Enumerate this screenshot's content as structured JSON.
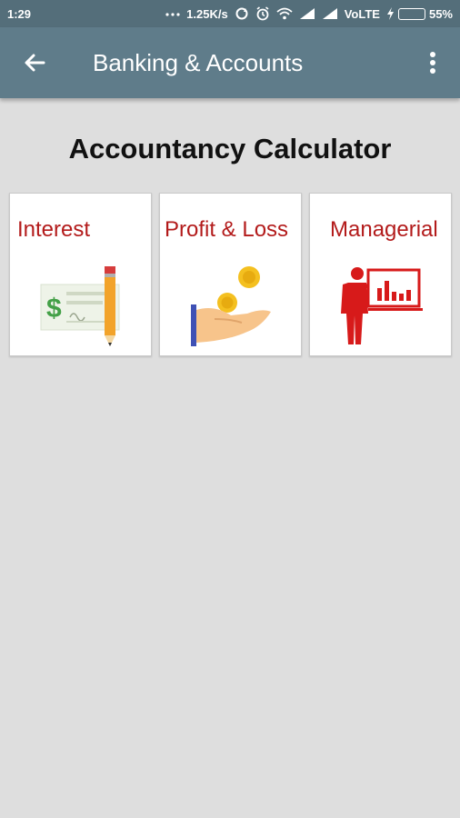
{
  "status": {
    "time": "1:29",
    "speed": "1.25K/s",
    "network": "VoLTE",
    "battery_percent": "55%",
    "battery_level": 0.55
  },
  "appbar": {
    "title": "Banking & Accounts",
    "back_icon": "arrow-left-icon",
    "menu_icon": "more-vert-icon"
  },
  "page": {
    "heading": "Accountancy Calculator"
  },
  "cards": [
    {
      "label": "Interest",
      "icon": "cheque-pencil-icon"
    },
    {
      "label": "Profit & Loss",
      "icon": "hand-coins-icon"
    },
    {
      "label": "Managerial",
      "icon": "presenter-chart-icon"
    }
  ],
  "colors": {
    "appbar": "#5f7c8a",
    "statusbar": "#546e7a",
    "card_label": "#b31b1b",
    "background": "#dedede"
  }
}
